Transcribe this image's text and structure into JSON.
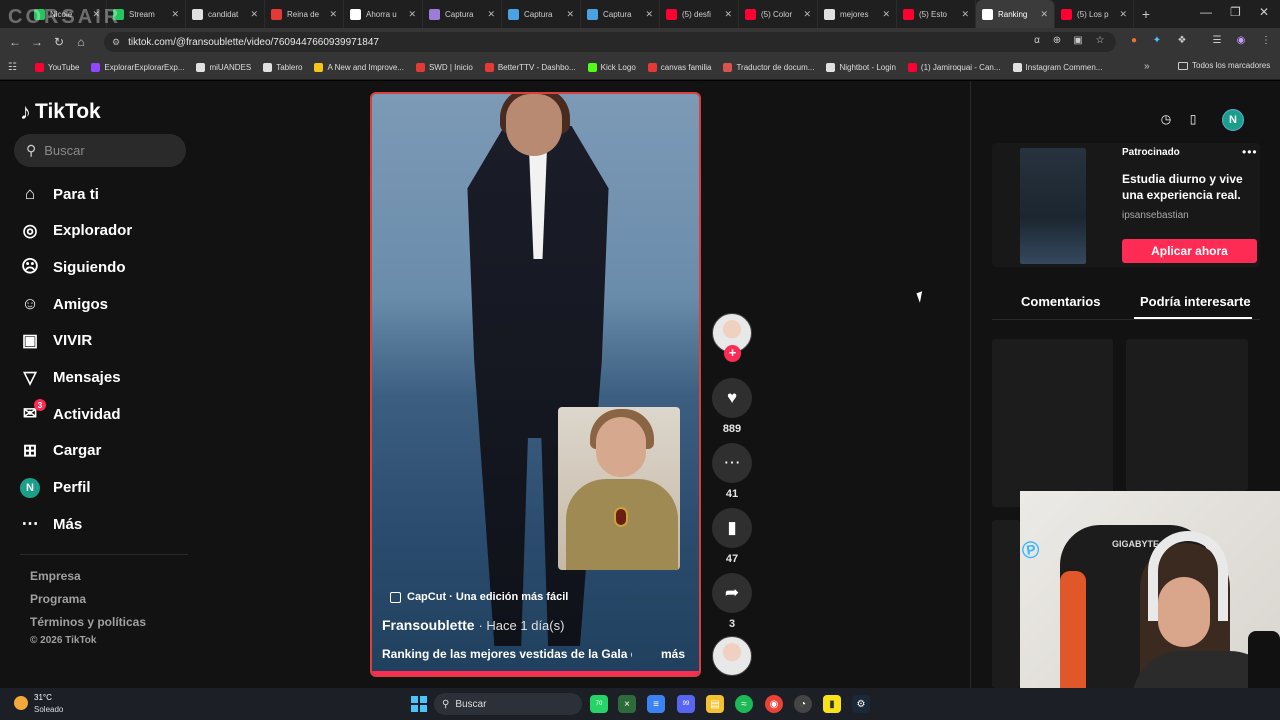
{
  "browser": {
    "overlay_logo": "CORSAIR",
    "tabs": [
      {
        "title": "Nicole",
        "color": "#22c55e"
      },
      {
        "title": "Stream",
        "color": "#22c55e"
      },
      {
        "title": "candidat",
        "color": "#e0e0e0"
      },
      {
        "title": "Reina de",
        "color": "#e53935"
      },
      {
        "title": "Ahorra u",
        "color": "#ffffff"
      },
      {
        "title": "Captura",
        "color": "#9c7bd9"
      },
      {
        "title": "Captura",
        "color": "#4aa3e0"
      },
      {
        "title": "Captura",
        "color": "#4aa3e0"
      },
      {
        "title": "(5) desfi",
        "color": "#ff0033"
      },
      {
        "title": "(5) Color",
        "color": "#ff0033"
      },
      {
        "title": "mejores",
        "color": "#e0e0e0"
      },
      {
        "title": "(5) Esto",
        "color": "#ff0033"
      },
      {
        "title": "Ranking",
        "color": "#ffffff",
        "active": true
      },
      {
        "title": "(5) Los p",
        "color": "#ff0033"
      }
    ],
    "url": "tiktok.com/@fransoublette/video/7609447660939971847",
    "bookmarks": [
      {
        "label": "YouTube",
        "color": "#ff0033"
      },
      {
        "label": "ExplorarExplorarExp...",
        "color": "#9146ff"
      },
      {
        "label": "miUANDES",
        "color": "#e0e0e0"
      },
      {
        "label": "Tablero",
        "color": "#e0e0e0"
      },
      {
        "label": "A New and Improve...",
        "color": "#f5c518"
      },
      {
        "label": "SWD | Inicio",
        "color": "#e53935"
      },
      {
        "label": "BetterTTV - Dashbo...",
        "color": "#e53935"
      },
      {
        "label": "Kick Logo",
        "color": "#53fc18"
      },
      {
        "label": "canvas familia",
        "color": "#e53935"
      },
      {
        "label": "Traductor de docum...",
        "color": "#d9534f"
      },
      {
        "label": "Nightbot - Login",
        "color": "#e0e0e0"
      },
      {
        "label": "(1) Jamiroquai - Can...",
        "color": "#ff0033"
      },
      {
        "label": "Instagram Commen...",
        "color": "#e0e0e0"
      }
    ],
    "all_bookmarks": "Todos los marcadores"
  },
  "tiktok": {
    "logo": "TikTok",
    "search_placeholder": "Buscar",
    "nav": [
      {
        "label": "Para ti",
        "icon": "home-icon"
      },
      {
        "label": "Explorador",
        "icon": "compass-icon"
      },
      {
        "label": "Siguiendo",
        "icon": "following-icon"
      },
      {
        "label": "Amigos",
        "icon": "friends-icon"
      },
      {
        "label": "VIVIR",
        "icon": "live-icon"
      },
      {
        "label": "Mensajes",
        "icon": "messages-icon"
      },
      {
        "label": "Actividad",
        "icon": "activity-icon",
        "badge": "3"
      },
      {
        "label": "Cargar",
        "icon": "upload-icon"
      },
      {
        "label": "Perfil",
        "icon": "profile-icon",
        "initial": "N"
      },
      {
        "label": "Más",
        "icon": "more-icon"
      }
    ],
    "footer": [
      "Empresa",
      "Programa",
      "Términos y políticas"
    ],
    "copyright": "© 2026 TikTok",
    "video": {
      "capcut": "CapCut · Una edición más fácil",
      "author": "Fransoublette",
      "time": "· Hace 1 día(s)",
      "description": "Ranking de las mejores vestidas de la Gala de",
      "more": "más"
    },
    "actions": {
      "likes": "889",
      "comments": "41",
      "saves": "47",
      "shares": "3"
    },
    "profile_initial": "N",
    "ad": {
      "sponsored": "Patrocinado",
      "text": "Estudia diurno y vive una experiencia real.",
      "handle": "ipsansebastian",
      "cta": "Aplicar ahora"
    },
    "tabs": {
      "comments": "Comentarios",
      "related": "Podría interesarte"
    }
  },
  "webcam": {
    "chair_brand": "GIGABYTE"
  },
  "taskbar": {
    "temp": "31°C",
    "condition": "Soleado",
    "search": "Buscar",
    "chat_badge": "70",
    "discord_badge": "99"
  }
}
